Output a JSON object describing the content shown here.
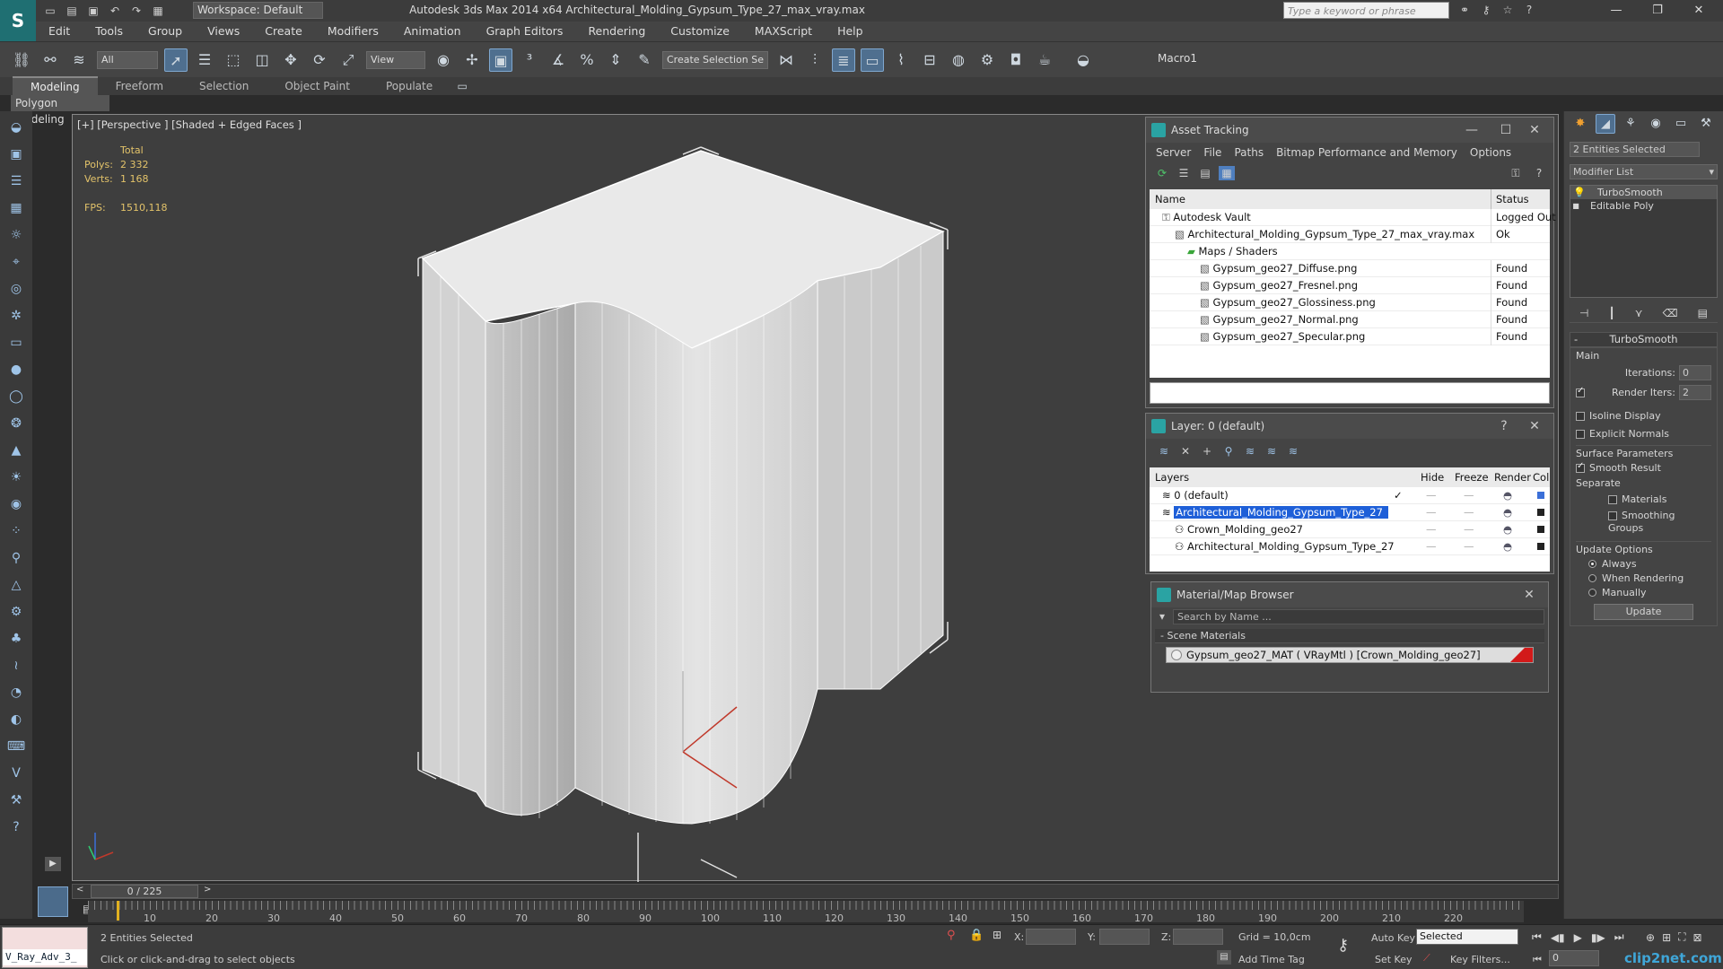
{
  "title_bar": {
    "workspace": "Workspace: Default",
    "window_title": "Autodesk 3ds Max  2014 x64     Architectural_Molding_Gypsum_Type_27_max_vray.max",
    "search_placeholder": "Type a keyword or phrase"
  },
  "menu": [
    "Edit",
    "Tools",
    "Group",
    "Views",
    "Create",
    "Modifiers",
    "Animation",
    "Graph Editors",
    "Rendering",
    "Customize",
    "MAXScript",
    "Help"
  ],
  "toolbar": {
    "filter_value": "All",
    "refcoord_value": "View",
    "selection_set_placeholder": "Create Selection Se",
    "macro": "Macro1"
  },
  "ribbon": {
    "tabs": [
      "Modeling",
      "Freeform",
      "Selection",
      "Object Paint",
      "Populate"
    ],
    "subpanel": "Polygon Modeling"
  },
  "viewport": {
    "label": "[+] [Perspective ] [Shaded + Edged Faces ]",
    "stats": {
      "total": "Total",
      "polys_label": "Polys:",
      "polys_value": "2 332",
      "verts_label": "Verts:",
      "verts_value": "1 168",
      "fps_label": "FPS:",
      "fps_value": "1510,118"
    }
  },
  "asset_tracking": {
    "title": "Asset Tracking",
    "menu": [
      "Server",
      "File",
      "Paths",
      "Bitmap Performance and Memory",
      "Options"
    ],
    "columns": [
      "Name",
      "Status"
    ],
    "rows": [
      {
        "name": "Autodesk Vault",
        "status": "Logged Out",
        "indent": 1
      },
      {
        "name": "Architectural_Molding_Gypsum_Type_27_max_vray.max",
        "status": "Ok",
        "indent": 2
      },
      {
        "name": "Maps / Shaders",
        "status": "",
        "indent": 3
      },
      {
        "name": "Gypsum_geo27_Diffuse.png",
        "status": "Found",
        "indent": 4
      },
      {
        "name": "Gypsum_geo27_Fresnel.png",
        "status": "Found",
        "indent": 4
      },
      {
        "name": "Gypsum_geo27_Glossiness.png",
        "status": "Found",
        "indent": 4
      },
      {
        "name": "Gypsum_geo27_Normal.png",
        "status": "Found",
        "indent": 4
      },
      {
        "name": "Gypsum_geo27_Specular.png",
        "status": "Found",
        "indent": 4
      }
    ]
  },
  "layer_dialog": {
    "title": "Layer: 0 (default)",
    "columns": [
      "Layers",
      "Hide",
      "Freeze",
      "Render",
      "Col"
    ],
    "rows": [
      {
        "name": "0 (default)",
        "indent": 1,
        "selected": false
      },
      {
        "name": "Architectural_Molding_Gypsum_Type_27",
        "indent": 1,
        "selected": true
      },
      {
        "name": "Crown_Molding_geo27",
        "indent": 2,
        "selected": false
      },
      {
        "name": "Architectural_Molding_Gypsum_Type_27",
        "indent": 2,
        "selected": false
      }
    ]
  },
  "material_browser": {
    "title": "Material/Map Browser",
    "search_placeholder": "Search by Name ...",
    "section": "Scene Materials",
    "item": "Gypsum_geo27_MAT ( VRayMtl ) [Crown_Molding_geo27]"
  },
  "command_panel": {
    "selection": "2 Entities Selected",
    "modifier_list": "Modifier List",
    "stack": [
      "TurboSmooth",
      "Editable Poly"
    ],
    "rollout_title": "TurboSmooth",
    "main_label": "Main",
    "iterations_label": "Iterations:",
    "iterations_value": "0",
    "render_iters_label": "Render Iters:",
    "render_iters_value": "2",
    "isoline": "Isoline Display",
    "explicit_normals": "Explicit Normals",
    "surface_params": "Surface Parameters",
    "smooth_result": "Smooth Result",
    "separate": "Separate",
    "materials": "Materials",
    "smoothing_groups": "Smoothing Groups",
    "update_options": "Update Options",
    "always": "Always",
    "when_rendering": "When Rendering",
    "manually": "Manually",
    "update_btn": "Update"
  },
  "timeline": {
    "frame": "0 / 225",
    "ticks": [
      "10",
      "20",
      "30",
      "40",
      "50",
      "60",
      "70",
      "80",
      "90",
      "100",
      "110",
      "120",
      "130",
      "140",
      "150",
      "160",
      "170",
      "180",
      "190",
      "200",
      "210",
      "220"
    ]
  },
  "status": {
    "script_field": "V_Ray_Adv_3_",
    "entities": "2 Entities Selected",
    "prompt": "Click or click-and-drag to select objects",
    "x_label": "X:",
    "y_label": "Y:",
    "z_label": "Z:",
    "grid": "Grid = 10,0cm",
    "add_time_tag": "Add Time Tag",
    "auto_key": "Auto Key",
    "set_key": "Set Key",
    "selected_dd": "Selected",
    "key_filters": "Key Filters...",
    "frame_field": "0",
    "watermark": "clip2net.com"
  }
}
